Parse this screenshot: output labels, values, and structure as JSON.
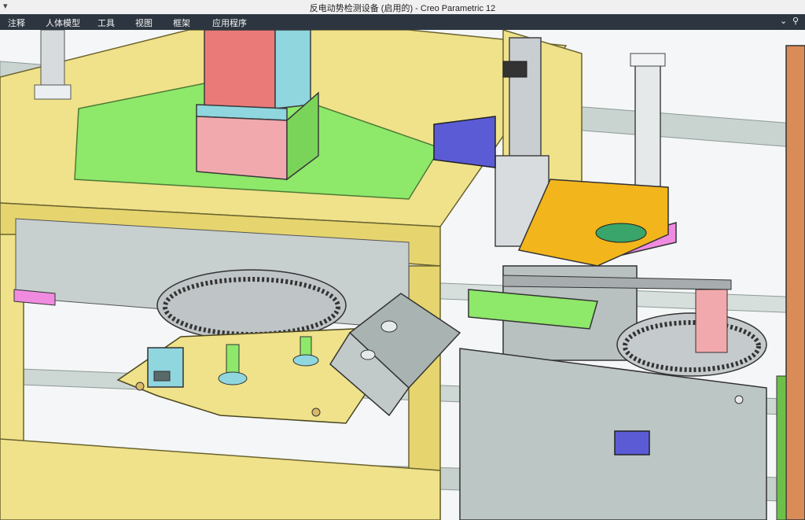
{
  "window": {
    "title": "反电动势检测设备 (启用的) - Creo Parametric 12",
    "system_menu_icon": "chevron-down-icon"
  },
  "menubar": {
    "items": [
      {
        "label": "注释"
      },
      {
        "label": "人体模型"
      },
      {
        "label": "工具"
      },
      {
        "label": "视图"
      },
      {
        "label": "框架"
      },
      {
        "label": "应用程序"
      }
    ],
    "right_icons": [
      "chevron-down-icon",
      "help-icon"
    ]
  },
  "viewport": {
    "content": "3d-model-view"
  },
  "colors": {
    "menubar_bg": "#2d3640",
    "frame_yellow": "#f0e28a",
    "plate_green": "#8ee86a",
    "block_red": "#ea7a78",
    "block_teal": "#8fd6df",
    "cylinder_grey": "#c9ced2",
    "purple_blue": "#5b5bd6",
    "orange": "#f2b51c",
    "pink": "#f08be0"
  }
}
